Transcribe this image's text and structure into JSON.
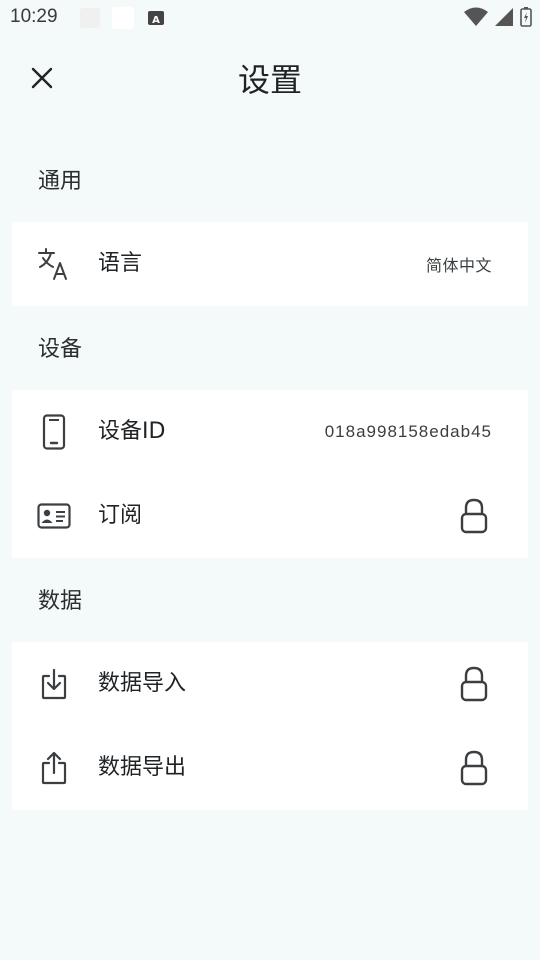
{
  "status_bar": {
    "time": "10:29"
  },
  "header": {
    "title": "设置"
  },
  "sections": {
    "general": {
      "title": "通用",
      "language": {
        "label": "语言",
        "value": "简体中文"
      }
    },
    "device": {
      "title": "设备",
      "device_id": {
        "label": "设备ID",
        "value": "018a998158edab45"
      },
      "subscription": {
        "label": "订阅"
      }
    },
    "data": {
      "title": "数据",
      "import": {
        "label": "数据导入"
      },
      "export": {
        "label": "数据导出"
      }
    }
  },
  "colors": {
    "background": "#f4f9f9",
    "card": "#ffffff",
    "text": "#1f2326",
    "icon": "#3b3f42"
  }
}
